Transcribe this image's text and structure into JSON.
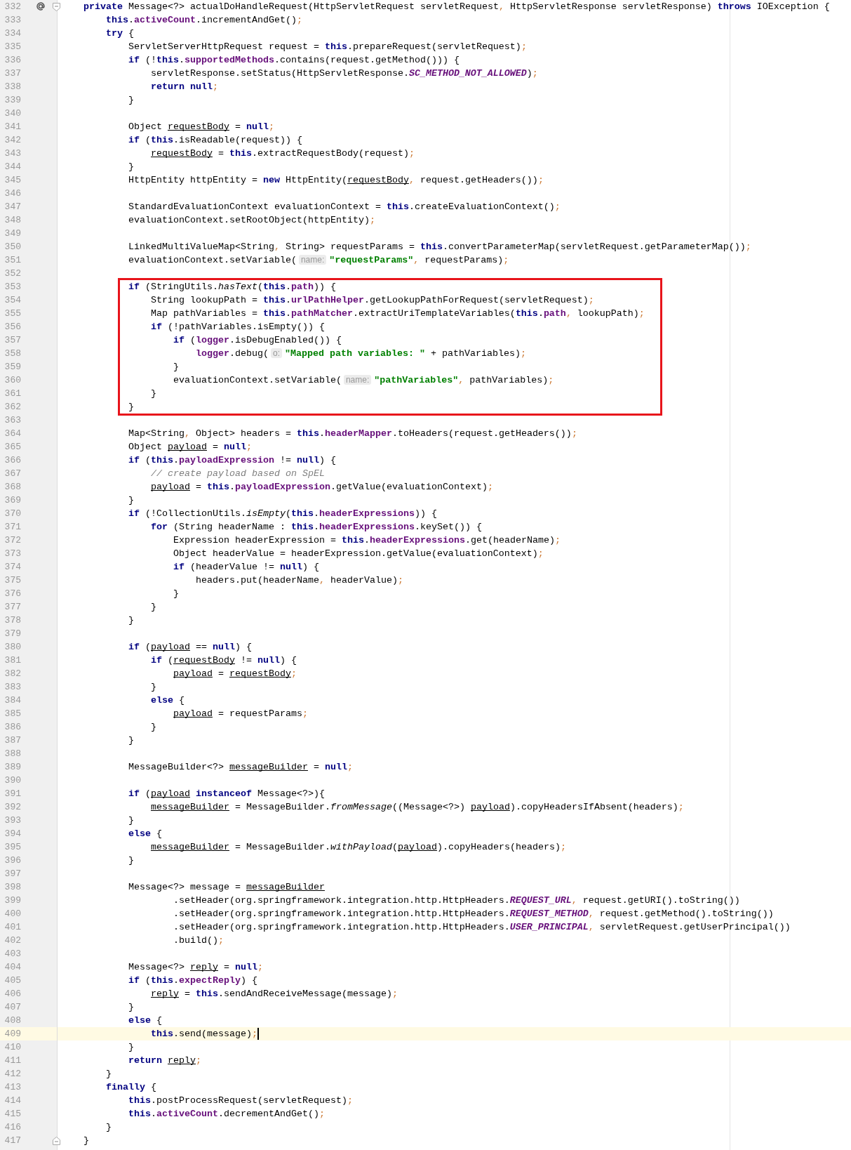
{
  "editor": {
    "lines": [
      {
        "number": "332",
        "annotation_marker": true,
        "fold_open": true,
        "segments": [
          {
            "kind": "keyword",
            "text": "    private"
          },
          " Message<?> actualDoHandleRequest(HttpServletRequest servletRequest, HttpServletResponse servletResponse) ",
          {
            "kind": "keyword",
            "text": "throws"
          },
          " IOException {"
        ]
      },
      {
        "number": "333",
        "segments": [
          {
            "kind": "keyword",
            "text": "        this"
          },
          ".",
          {
            "kind": "field",
            "text": "activeCount"
          },
          ".incrementAndGet();"
        ]
      },
      {
        "number": "334",
        "segments": [
          {
            "kind": "keyword",
            "text": "        try"
          },
          " {"
        ]
      },
      {
        "number": "335",
        "segments": [
          "            ServletServerHttpRequest request = ",
          {
            "kind": "keyword",
            "text": "this"
          },
          ".prepareRequest(servletRequest);"
        ]
      },
      {
        "number": "336",
        "segments": [
          {
            "kind": "keyword",
            "text": "            if"
          },
          " (!",
          {
            "kind": "keyword",
            "text": "this"
          },
          ".",
          {
            "kind": "field",
            "text": "supportedMethods"
          },
          ".contains(request.getMethod())) {"
        ]
      },
      {
        "number": "337",
        "segments": [
          "                servletResponse.setStatus(HttpServletResponse.",
          {
            "kind": "constant",
            "text": "SC_METHOD_NOT_ALLOWED"
          },
          ");"
        ]
      },
      {
        "number": "338",
        "segments": [
          {
            "kind": "keyword",
            "text": "                return null"
          },
          ";"
        ]
      },
      {
        "number": "339",
        "segments": [
          "            }"
        ]
      },
      {
        "number": "340"
      },
      {
        "number": "341",
        "segments": [
          "            Object ",
          {
            "kind": "reassigned",
            "text": "requestBody"
          },
          " = ",
          {
            "kind": "keyword",
            "text": "null"
          },
          ";"
        ]
      },
      {
        "number": "342",
        "segments": [
          {
            "kind": "keyword",
            "text": "            if"
          },
          " (",
          {
            "kind": "keyword",
            "text": "this"
          },
          ".isReadable(request)) {"
        ]
      },
      {
        "number": "343",
        "segments": [
          {
            "kind": "reassigned",
            "text": "                requestBody"
          },
          " = ",
          {
            "kind": "keyword",
            "text": "this"
          },
          ".extractRequestBody(request);"
        ]
      },
      {
        "number": "344",
        "segments": [
          "            }"
        ]
      },
      {
        "number": "345",
        "segments": [
          "            HttpEntity httpEntity = ",
          {
            "kind": "keyword",
            "text": "new"
          },
          " HttpEntity(",
          {
            "kind": "reassigned",
            "text": "requestBody"
          },
          ", request.getHeaders());"
        ]
      },
      {
        "number": "346"
      },
      {
        "number": "347",
        "segments": [
          "            StandardEvaluationContext evaluationContext = ",
          {
            "kind": "keyword",
            "text": "this"
          },
          ".createEvaluationContext();"
        ]
      },
      {
        "number": "348",
        "segments": [
          "            evaluationContext.setRootObject(httpEntity);"
        ]
      },
      {
        "number": "349"
      },
      {
        "number": "350",
        "segments": [
          "            LinkedMultiValueMap<String, String> requestParams = ",
          {
            "kind": "keyword",
            "text": "this"
          },
          ".convertParameterMap(servletRequest.getParameterMap());"
        ]
      },
      {
        "number": "351",
        "segments": [
          "            evaluationContext.setVariable(",
          {
            "kind": "hint",
            "text": "name:"
          },
          {
            "kind": "string",
            "text": "\"requestParams\""
          },
          ", requestParams);"
        ]
      },
      {
        "number": "352"
      },
      {
        "number": "353",
        "highlighted": true,
        "segments": [
          {
            "kind": "keyword",
            "text": "            if"
          },
          " (StringUtils.",
          {
            "kind": "static",
            "text": "hasText"
          },
          "(",
          {
            "kind": "keyword",
            "text": "this"
          },
          ".",
          {
            "kind": "field",
            "text": "path"
          },
          ")) {"
        ]
      },
      {
        "number": "354",
        "highlighted": true,
        "segments": [
          "                String lookupPath = ",
          {
            "kind": "keyword",
            "text": "this"
          },
          ".",
          {
            "kind": "field",
            "text": "urlPathHelper"
          },
          ".getLookupPathForRequest(servletRequest);"
        ]
      },
      {
        "number": "355",
        "highlighted": true,
        "segments": [
          "                Map pathVariables = ",
          {
            "kind": "keyword",
            "text": "this"
          },
          ".",
          {
            "kind": "field",
            "text": "pathMatcher"
          },
          ".extractUriTemplateVariables(",
          {
            "kind": "keyword",
            "text": "this"
          },
          ".",
          {
            "kind": "field",
            "text": "path"
          },
          ", lookupPath);"
        ]
      },
      {
        "number": "356",
        "highlighted": true,
        "segments": [
          {
            "kind": "keyword",
            "text": "                if"
          },
          " (!pathVariables.isEmpty()) {"
        ]
      },
      {
        "number": "357",
        "highlighted": true,
        "segments": [
          {
            "kind": "keyword",
            "text": "                    if"
          },
          " (",
          {
            "kind": "field",
            "text": "logger"
          },
          ".isDebugEnabled()) {"
        ]
      },
      {
        "number": "358",
        "highlighted": true,
        "segments": [
          {
            "kind": "field",
            "text": "                        logger"
          },
          ".debug(",
          {
            "kind": "hint",
            "text": "o:"
          },
          {
            "kind": "string",
            "text": "\"Mapped path variables: \""
          },
          " + pathVariables);"
        ]
      },
      {
        "number": "359",
        "highlighted": true,
        "segments": [
          "                    }"
        ]
      },
      {
        "number": "360",
        "highlighted": true,
        "segments": [
          "                    evaluationContext.setVariable(",
          {
            "kind": "hint",
            "text": "name:"
          },
          {
            "kind": "string",
            "text": "\"pathVariables\""
          },
          ", pathVariables);"
        ]
      },
      {
        "number": "361",
        "highlighted": true,
        "segments": [
          "                }"
        ]
      },
      {
        "number": "362",
        "highlighted": true,
        "segments": [
          "            }"
        ]
      },
      {
        "number": "363"
      },
      {
        "number": "364",
        "segments": [
          "            Map<String, Object> headers = ",
          {
            "kind": "keyword",
            "text": "this"
          },
          ".",
          {
            "kind": "field",
            "text": "headerMapper"
          },
          ".toHeaders(request.getHeaders());"
        ]
      },
      {
        "number": "365",
        "segments": [
          "            Object ",
          {
            "kind": "reassigned",
            "text": "payload"
          },
          " = ",
          {
            "kind": "keyword",
            "text": "null"
          },
          ";"
        ]
      },
      {
        "number": "366",
        "segments": [
          {
            "kind": "keyword",
            "text": "            if"
          },
          " (",
          {
            "kind": "keyword",
            "text": "this"
          },
          ".",
          {
            "kind": "field",
            "text": "payloadExpression"
          },
          " != ",
          {
            "kind": "keyword",
            "text": "null"
          },
          ") {"
        ]
      },
      {
        "number": "367",
        "segments": [
          {
            "kind": "comment",
            "text": "                // create payload based on SpEL"
          }
        ]
      },
      {
        "number": "368",
        "segments": [
          {
            "kind": "reassigned",
            "text": "                payload"
          },
          " = ",
          {
            "kind": "keyword",
            "text": "this"
          },
          ".",
          {
            "kind": "field",
            "text": "payloadExpression"
          },
          ".getValue(evaluationContext);"
        ]
      },
      {
        "number": "369",
        "segments": [
          "            }"
        ]
      },
      {
        "number": "370",
        "segments": [
          {
            "kind": "keyword",
            "text": "            if"
          },
          " (!CollectionUtils.",
          {
            "kind": "static",
            "text": "isEmpty"
          },
          "(",
          {
            "kind": "keyword",
            "text": "this"
          },
          ".",
          {
            "kind": "field",
            "text": "headerExpressions"
          },
          ")) {"
        ]
      },
      {
        "number": "371",
        "segments": [
          {
            "kind": "keyword",
            "text": "                for"
          },
          " (String headerName : ",
          {
            "kind": "keyword",
            "text": "this"
          },
          ".",
          {
            "kind": "field",
            "text": "headerExpressions"
          },
          ".keySet()) {"
        ]
      },
      {
        "number": "372",
        "segments": [
          "                    Expression headerExpression = ",
          {
            "kind": "keyword",
            "text": "this"
          },
          ".",
          {
            "kind": "field",
            "text": "headerExpressions"
          },
          ".get(headerName);"
        ]
      },
      {
        "number": "373",
        "segments": [
          "                    Object headerValue = headerExpression.getValue(evaluationContext);"
        ]
      },
      {
        "number": "374",
        "segments": [
          {
            "kind": "keyword",
            "text": "                    if"
          },
          " (headerValue != ",
          {
            "kind": "keyword",
            "text": "null"
          },
          ") {"
        ]
      },
      {
        "number": "375",
        "segments": [
          "                        headers.put(headerName, headerValue);"
        ]
      },
      {
        "number": "376",
        "segments": [
          "                    }"
        ]
      },
      {
        "number": "377",
        "segments": [
          "                }"
        ]
      },
      {
        "number": "378",
        "segments": [
          "            }"
        ]
      },
      {
        "number": "379"
      },
      {
        "number": "380",
        "segments": [
          {
            "kind": "keyword",
            "text": "            if"
          },
          " (",
          {
            "kind": "reassigned",
            "text": "payload"
          },
          " == ",
          {
            "kind": "keyword",
            "text": "null"
          },
          ") {"
        ]
      },
      {
        "number": "381",
        "segments": [
          {
            "kind": "keyword",
            "text": "                if"
          },
          " (",
          {
            "kind": "reassigned",
            "text": "requestBody"
          },
          " != ",
          {
            "kind": "keyword",
            "text": "null"
          },
          ") {"
        ]
      },
      {
        "number": "382",
        "segments": [
          {
            "kind": "reassigned",
            "text": "                    payload"
          },
          " = ",
          {
            "kind": "reassigned",
            "text": "requestBody"
          },
          ";"
        ]
      },
      {
        "number": "383",
        "segments": [
          "                }"
        ]
      },
      {
        "number": "384",
        "segments": [
          {
            "kind": "keyword",
            "text": "                else"
          },
          " {"
        ]
      },
      {
        "number": "385",
        "segments": [
          {
            "kind": "reassigned",
            "text": "                    payload"
          },
          " = requestParams;"
        ]
      },
      {
        "number": "386",
        "segments": [
          "                }"
        ]
      },
      {
        "number": "387",
        "segments": [
          "            }"
        ]
      },
      {
        "number": "388"
      },
      {
        "number": "389",
        "segments": [
          "            MessageBuilder<?> ",
          {
            "kind": "reassigned",
            "text": "messageBuilder"
          },
          " = ",
          {
            "kind": "keyword",
            "text": "null"
          },
          ";"
        ]
      },
      {
        "number": "390"
      },
      {
        "number": "391",
        "segments": [
          {
            "kind": "keyword",
            "text": "            if"
          },
          " (",
          {
            "kind": "reassigned",
            "text": "payload"
          },
          {
            "kind": "keyword",
            "text": " instanceof"
          },
          " Message<?>){"
        ]
      },
      {
        "number": "392",
        "segments": [
          {
            "kind": "reassigned",
            "text": "                messageBuilder"
          },
          " = MessageBuilder.",
          {
            "kind": "static",
            "text": "fromMessage"
          },
          "((Message<?>) ",
          {
            "kind": "reassigned",
            "text": "payload"
          },
          ").copyHeadersIfAbsent(headers);"
        ]
      },
      {
        "number": "393",
        "segments": [
          "            }"
        ]
      },
      {
        "number": "394",
        "segments": [
          {
            "kind": "keyword",
            "text": "            else"
          },
          " {"
        ]
      },
      {
        "number": "395",
        "segments": [
          {
            "kind": "reassigned",
            "text": "                messageBuilder"
          },
          " = MessageBuilder.",
          {
            "kind": "static",
            "text": "withPayload"
          },
          "(",
          {
            "kind": "reassigned",
            "text": "payload"
          },
          ").copyHeaders(headers);"
        ]
      },
      {
        "number": "396",
        "segments": [
          "            }"
        ]
      },
      {
        "number": "397"
      },
      {
        "number": "398",
        "segments": [
          "            Message<?> message = ",
          {
            "kind": "reassigned",
            "text": "messageBuilder"
          }
        ]
      },
      {
        "number": "399",
        "segments": [
          "                    .setHeader(org.springframework.integration.http.HttpHeaders.",
          {
            "kind": "constant",
            "text": "REQUEST_URL"
          },
          ", request.getURI().toString())"
        ]
      },
      {
        "number": "400",
        "segments": [
          "                    .setHeader(org.springframework.integration.http.HttpHeaders.",
          {
            "kind": "constant",
            "text": "REQUEST_METHOD"
          },
          ", request.getMethod().toString())"
        ]
      },
      {
        "number": "401",
        "segments": [
          "                    .setHeader(org.springframework.integration.http.HttpHeaders.",
          {
            "kind": "constant",
            "text": "USER_PRINCIPAL"
          },
          ", servletRequest.getUserPrincipal())"
        ]
      },
      {
        "number": "402",
        "segments": [
          "                    .build();"
        ]
      },
      {
        "number": "403"
      },
      {
        "number": "404",
        "segments": [
          "            Message<?> ",
          {
            "kind": "reassigned",
            "text": "reply"
          },
          " = ",
          {
            "kind": "keyword",
            "text": "null"
          },
          ";"
        ]
      },
      {
        "number": "405",
        "segments": [
          {
            "kind": "keyword",
            "text": "            if"
          },
          " (",
          {
            "kind": "keyword",
            "text": "this"
          },
          ".",
          {
            "kind": "field",
            "text": "expectReply"
          },
          ") {"
        ]
      },
      {
        "number": "406",
        "segments": [
          {
            "kind": "reassigned",
            "text": "                reply"
          },
          " = ",
          {
            "kind": "keyword",
            "text": "this"
          },
          ".sendAndReceiveMessage(message);"
        ]
      },
      {
        "number": "407",
        "segments": [
          "            }"
        ]
      },
      {
        "number": "408",
        "segments": [
          {
            "kind": "keyword",
            "text": "            else"
          },
          " {"
        ]
      },
      {
        "number": "409",
        "current": true,
        "caret": true,
        "segments": [
          {
            "kind": "keyword",
            "text": "                this"
          },
          ".send(message);"
        ]
      },
      {
        "number": "410",
        "segments": [
          "            }"
        ]
      },
      {
        "number": "411",
        "segments": [
          {
            "kind": "keyword",
            "text": "            return"
          },
          {
            "kind": "reassigned",
            "text": " reply"
          },
          ";"
        ]
      },
      {
        "number": "412",
        "segments": [
          "        }"
        ]
      },
      {
        "number": "413",
        "segments": [
          {
            "kind": "keyword",
            "text": "        finally"
          },
          " {"
        ]
      },
      {
        "number": "414",
        "segments": [
          {
            "kind": "keyword",
            "text": "            this"
          },
          ".postProcessRequest(servletRequest);"
        ]
      },
      {
        "number": "415",
        "segments": [
          {
            "kind": "keyword",
            "text": "            this"
          },
          ".",
          {
            "kind": "field",
            "text": "activeCount"
          },
          ".decrementAndGet();"
        ]
      },
      {
        "number": "416",
        "segments": [
          "        }"
        ]
      },
      {
        "number": "417",
        "fold_close": true,
        "segments": [
          "    }"
        ]
      }
    ]
  }
}
